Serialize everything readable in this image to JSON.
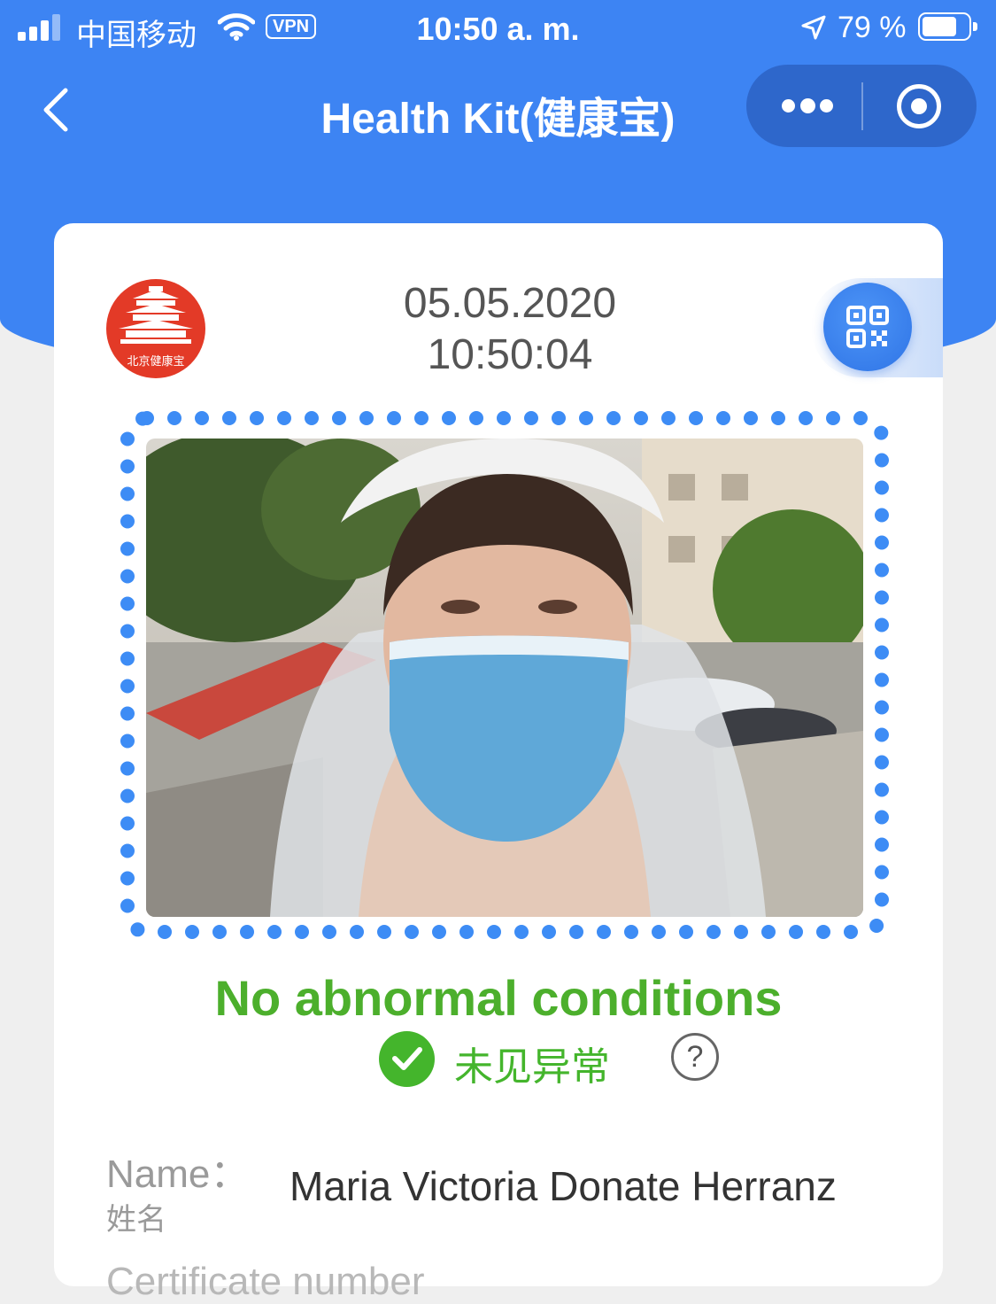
{
  "status_bar": {
    "carrier": "中国移动",
    "vpn": "VPN",
    "time": "10:50 a. m.",
    "battery": "79 %",
    "battery_level": 0.79
  },
  "nav": {
    "title": "Health Kit(健康宝)"
  },
  "card": {
    "logo_text": "北京健康宝",
    "date": "05.05.2020",
    "time": "10:50:04",
    "status_en": "No abnormal conditions",
    "status_cn": "未见异常",
    "help": "?",
    "name_label": "Name：",
    "name_label_cn": "姓名",
    "name_value": "Maria Victoria Donate Herranz",
    "next_label": "Certificate number"
  },
  "colors": {
    "accent_blue": "#3d84f3",
    "status_green": "#44b52c",
    "logo_red": "#e33a27"
  }
}
